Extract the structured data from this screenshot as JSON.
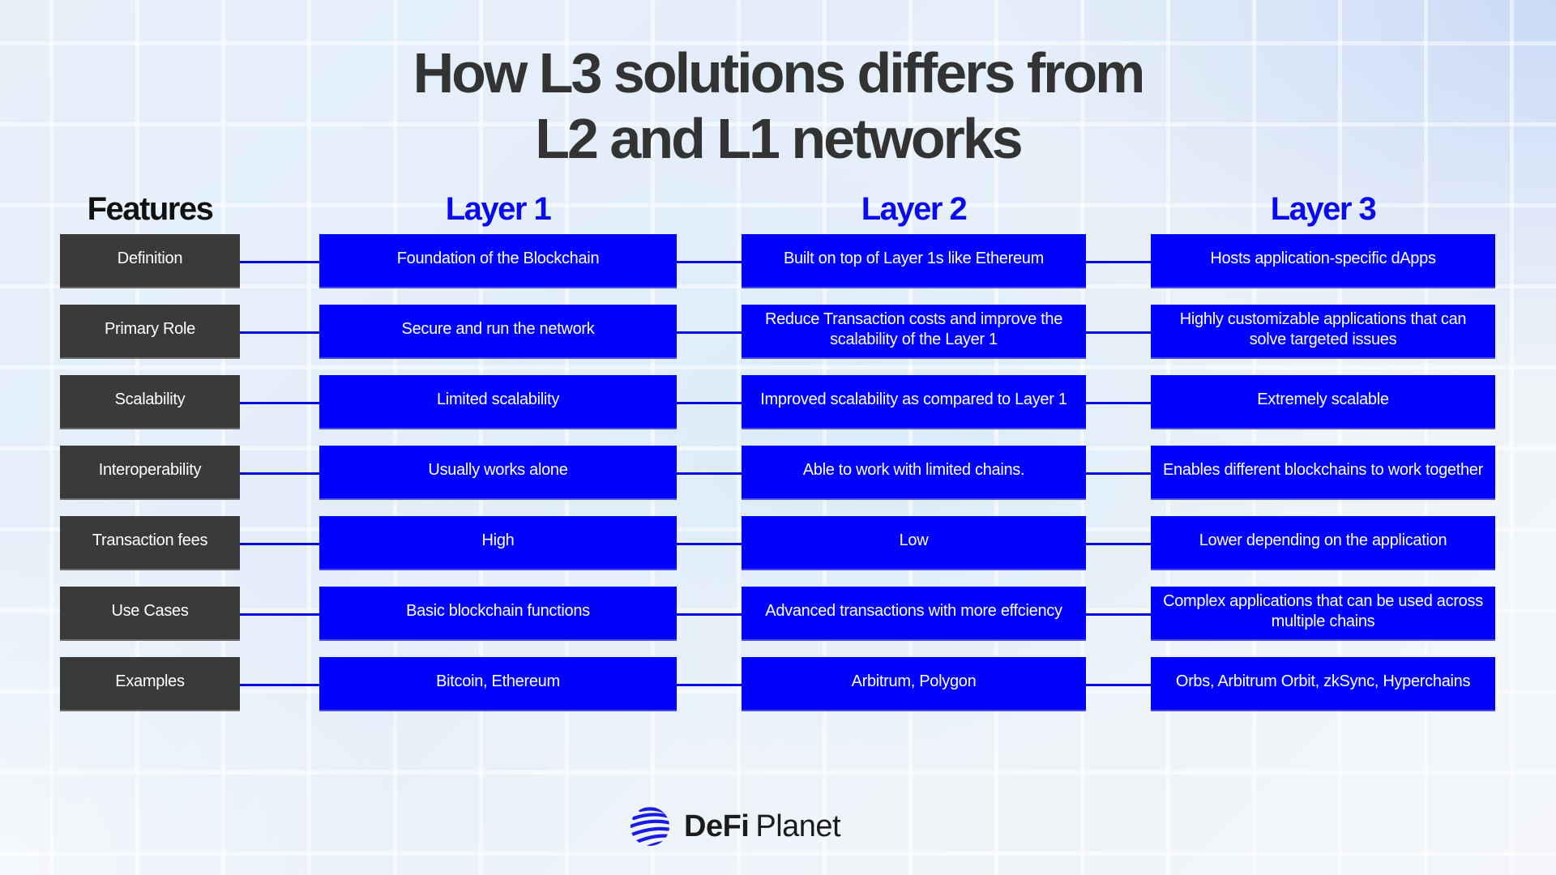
{
  "title": {
    "line1": "How L3 solutions differs from",
    "line2": "L2 and L1 networks"
  },
  "headers": {
    "features": "Features",
    "layer1": "Layer 1",
    "layer2": "Layer 2",
    "layer3": "Layer 3"
  },
  "colors": {
    "feature_box": "#3a3a3a",
    "layer_box": "#0000ff",
    "layer_header": "#0a0af0",
    "title": "#333333"
  },
  "rows": [
    {
      "feature": "Definition",
      "layer1": "Foundation of the Blockchain",
      "layer2": "Built on top of Layer 1s like Ethereum",
      "layer3": "Hosts application-specific dApps"
    },
    {
      "feature": "Primary Role",
      "layer1": "Secure and run the network",
      "layer2": "Reduce Transaction costs and improve the scalability of the Layer 1",
      "layer3": "Highly customizable applications that can solve targeted issues"
    },
    {
      "feature": "Scalability",
      "layer1": "Limited scalability",
      "layer2": "Improved scalability as compared to Layer 1",
      "layer3": "Extremely scalable"
    },
    {
      "feature": "Interoperability",
      "layer1": "Usually works alone",
      "layer2": "Able to work with limited chains.",
      "layer3": "Enables different blockchains to work together"
    },
    {
      "feature": "Transaction fees",
      "layer1": "High",
      "layer2": "Low",
      "layer3": "Lower depending on the application"
    },
    {
      "feature": "Use Cases",
      "layer1": "Basic blockchain functions",
      "layer2": "Advanced transactions with more effciency",
      "layer3": "Complex applications that can be used across multiple chains"
    },
    {
      "feature": "Examples",
      "layer1": "Bitcoin, Ethereum",
      "layer2": "Arbitrum, Polygon",
      "layer3": "Orbs, Arbitrum Orbit, zkSync, Hyperchains"
    }
  ],
  "logo": {
    "icon": "globe-icon",
    "brand_bold": "DeFi",
    "brand_regular": "Planet"
  }
}
